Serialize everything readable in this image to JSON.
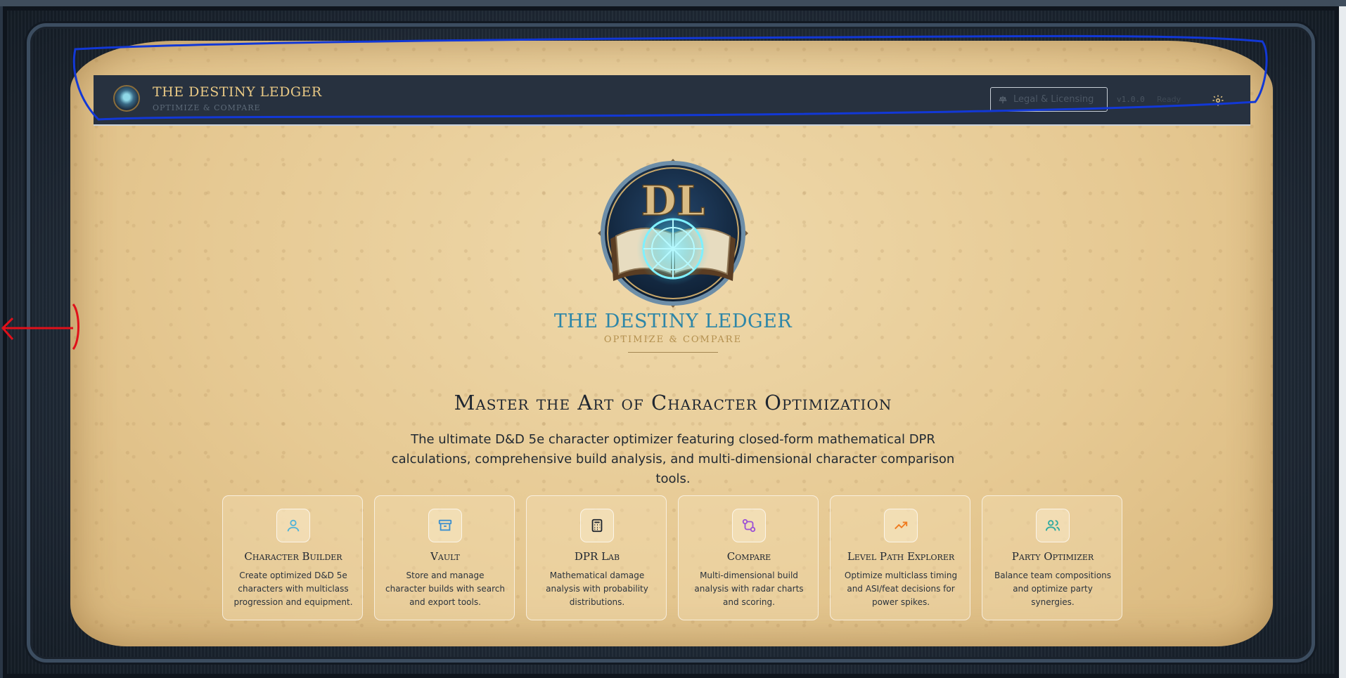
{
  "app": {
    "title": "THE DESTINY LEDGER",
    "subtitle": "OPTIMIZE & COMPARE"
  },
  "navbar": {
    "legal_label": "Legal & Licensing",
    "version": "v1.0.0",
    "status": "Ready"
  },
  "hero": {
    "title": "THE DESTINY LEDGER",
    "subtitle": "OPTIMIZE & COMPARE",
    "headline": "Master the Art of Character Optimization",
    "description": "The ultimate D&D 5e character optimizer featuring closed-form mathematical DPR calculations, comprehensive build analysis, and multi-dimensional character comparison tools."
  },
  "features": [
    {
      "title": "Character Builder",
      "desc": "Create optimized D&D 5e characters with multiclass progression and equipment.",
      "icon": "user-icon",
      "color": "#4fb3d9"
    },
    {
      "title": "Vault",
      "desc": "Store and manage character builds with search and export tools.",
      "icon": "archive-icon",
      "color": "#3a8fcf"
    },
    {
      "title": "DPR Lab",
      "desc": "Mathematical damage analysis with probability distributions.",
      "icon": "calculator-icon",
      "color": "#1f2630"
    },
    {
      "title": "Compare",
      "desc": "Multi-dimensional build analysis with radar charts and scoring.",
      "icon": "git-compare-icon",
      "color": "#9b4fd6"
    },
    {
      "title": "Level Path Explorer",
      "desc": "Optimize multiclass timing and ASI/feat decisions for power spikes.",
      "icon": "trending-up-icon",
      "color": "#f07a1e"
    },
    {
      "title": "Party Optimizer",
      "desc": "Balance team compositions and optimize party synergies.",
      "icon": "users-icon",
      "color": "#2eaaa0"
    }
  ],
  "colors": {
    "navbar_bg": "#27313f",
    "brand_gold": "#e9c985",
    "hero_blue": "#2d86a8",
    "annotation_blue": "#1238d6",
    "annotation_red": "#e0101a"
  }
}
